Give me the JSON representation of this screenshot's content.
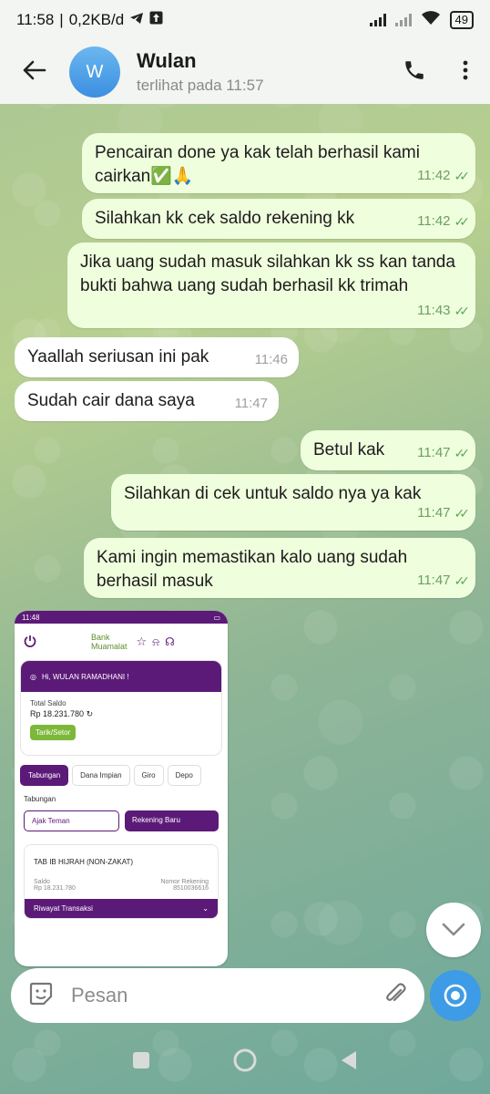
{
  "status_bar": {
    "time": "11:58",
    "network_speed": "0,2KB/d",
    "battery": "49"
  },
  "header": {
    "avatar_initial": "W",
    "name": "Wulan",
    "status": "terlihat pada  11:57"
  },
  "messages": [
    {
      "dir": "out",
      "text": "Pencairan done ya kak telah berhasil kami cairkan✅🙏",
      "time": "11:42"
    },
    {
      "dir": "out",
      "text": "Silahkan kk cek saldo rekening kk",
      "time": "11:42"
    },
    {
      "dir": "out",
      "text": "Jika uang sudah masuk silahkan kk ss kan tanda bukti bahwa uang sudah berhasil kk trimah",
      "time": "11:43"
    },
    {
      "dir": "in",
      "text": "Yaallah seriusan ini pak",
      "time": "11:46"
    },
    {
      "dir": "in",
      "text": "Sudah cair dana saya",
      "time": "11:47"
    },
    {
      "dir": "out",
      "text": "Betul kak",
      "time": "11:47"
    },
    {
      "dir": "out",
      "text": "Silahkan di cek untuk saldo nya ya kak",
      "time": "11:47"
    },
    {
      "dir": "out",
      "text": "Kami ingin memastikan kalo uang sudah berhasil masuk",
      "time": "11:47"
    }
  ],
  "screenshot": {
    "time": "11:48",
    "brand_line1": "Bank",
    "brand_line2": "Muamalat",
    "greeting": "Hi, WULAN RAMADHANI !",
    "total_label": "Total Saldo",
    "total_value": "Rp 18.231.780",
    "topup_button": "Tarik/Setor",
    "tabs": [
      "Tabungan",
      "Dana Impian",
      "Giro",
      "Depo"
    ],
    "section_title": "Tabungan",
    "invite_button": "Ajak Teman",
    "new_account_button": "Rekening Baru",
    "account_name": "TAB IB HIJRAH (NON-ZAKAT)",
    "saldo_label": "Saldo",
    "saldo_value": "Rp 18.231.780",
    "account_number_label": "Nomor Rekening",
    "account_number": "8510036616",
    "history": "Riwayat Transaksi"
  },
  "composer": {
    "placeholder": "Pesan"
  },
  "colors": {
    "outgoing_bubble": "#effedd",
    "incoming_bubble": "#ffffff",
    "check_green": "#5fa65b",
    "muamalat_purple": "#5c1a78",
    "send_blue": "#3e9be6"
  }
}
